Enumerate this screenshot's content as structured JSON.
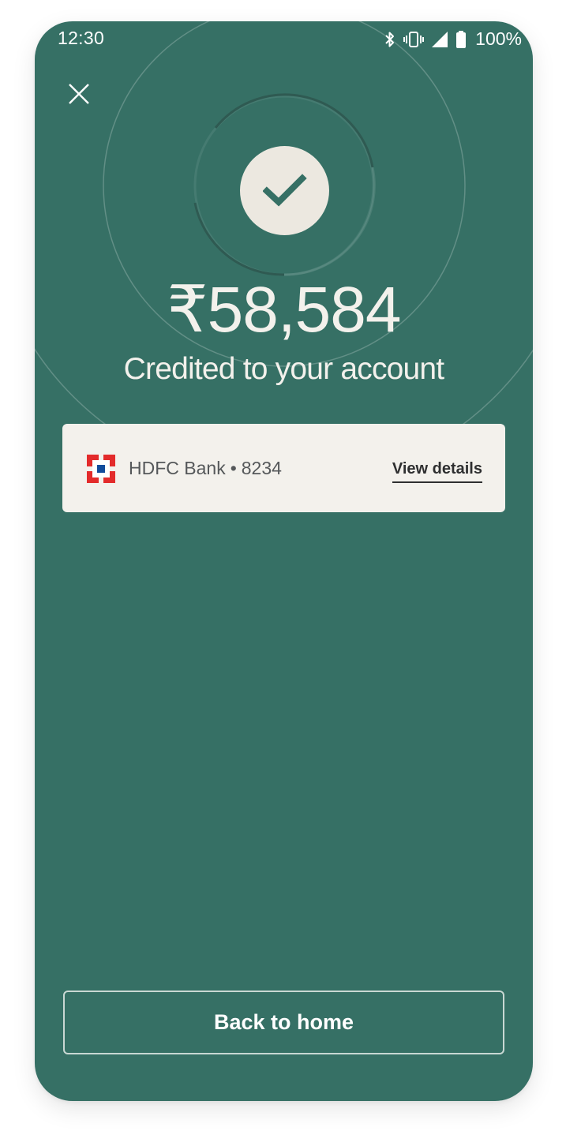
{
  "status_bar": {
    "time": "12:30",
    "battery_percent": "100%",
    "icons": [
      "bluetooth-icon",
      "vibrate-icon",
      "signal-icon",
      "battery-icon"
    ]
  },
  "header": {
    "close_icon": "close-icon"
  },
  "result": {
    "status_icon": "checkmark-icon",
    "amount": "₹58,584",
    "message": "Credited to your account"
  },
  "bank_card": {
    "logo": "hdfc-bank-logo",
    "bank_name": "HDFC Bank",
    "separator": "•",
    "account_last4": "8234",
    "view_details_label": "View details"
  },
  "footer": {
    "back_home_label": "Back to home"
  },
  "colors": {
    "background": "#367065",
    "surface": "#f3f1ec",
    "check_circle": "#ece8e0",
    "logo_red": "#e32b2b",
    "logo_blue": "#124c9c"
  }
}
